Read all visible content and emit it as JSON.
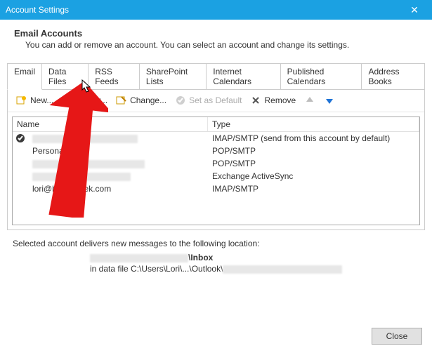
{
  "window": {
    "title": "Account Settings"
  },
  "header": {
    "title": "Email Accounts",
    "subtitle": "You can add or remove an account. You can select an account and change its settings."
  },
  "tabs": [
    "Email",
    "Data Files",
    "RSS Feeds",
    "SharePoint Lists",
    "Internet Calendars",
    "Published Calendars",
    "Address Books"
  ],
  "toolbar": {
    "new": "New...",
    "repair": "Repair...",
    "change": "Change...",
    "default": "Set as Default",
    "remove": "Remove"
  },
  "columns": {
    "name": "Name",
    "type": "Type"
  },
  "accounts": [
    {
      "name": "",
      "type": "IMAP/SMTP (send from this account by default)",
      "default": true
    },
    {
      "name": "Personal",
      "type": "POP/SMTP",
      "default": false
    },
    {
      "name": "",
      "type": "POP/SMTP",
      "default": false
    },
    {
      "name": "",
      "type": "Exchange ActiveSync",
      "default": false
    },
    {
      "name": "lori@howtogeek.com",
      "type": "IMAP/SMTP",
      "default": false
    }
  ],
  "delivery": {
    "intro": "Selected account delivers new messages to the following location:",
    "inbox_suffix": "\\Inbox",
    "datafile_prefix": "in data file C:\\Users\\Lori\\...\\Outlook\\"
  },
  "buttons": {
    "close": "Close"
  }
}
